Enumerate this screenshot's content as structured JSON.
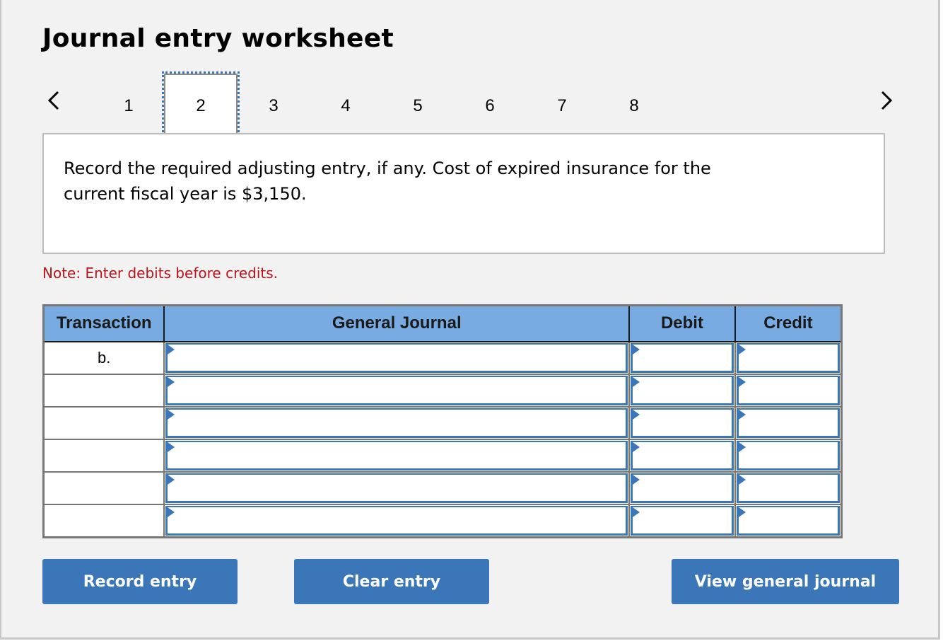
{
  "header": {
    "title": "Journal entry worksheet"
  },
  "pager": {
    "prev_icon": "chevron-left-icon",
    "next_icon": "chevron-right-icon",
    "tabs": [
      "1",
      "2",
      "3",
      "4",
      "5",
      "6",
      "7",
      "8"
    ],
    "active_tab": "2"
  },
  "question": {
    "line1": "Record the required adjusting entry, if any. Cost of expired insurance for the",
    "line2": "current fiscal year is $3,150."
  },
  "note": "Note: Enter debits before credits.",
  "journal": {
    "columns": [
      "Transaction",
      "General Journal",
      "Debit",
      "Credit"
    ],
    "rows": [
      {
        "transaction": "b.",
        "account": "",
        "debit": "",
        "credit": ""
      },
      {
        "transaction": "",
        "account": "",
        "debit": "",
        "credit": ""
      },
      {
        "transaction": "",
        "account": "",
        "debit": "",
        "credit": ""
      },
      {
        "transaction": "",
        "account": "",
        "debit": "",
        "credit": ""
      },
      {
        "transaction": "",
        "account": "",
        "debit": "",
        "credit": ""
      },
      {
        "transaction": "",
        "account": "",
        "debit": "",
        "credit": ""
      }
    ]
  },
  "buttons": {
    "record": "Record entry",
    "clear": "Clear entry",
    "view": "View general journal"
  },
  "colors": {
    "accent": "#3a76b8",
    "header_bg": "#78abe1",
    "note": "#b8141b"
  }
}
